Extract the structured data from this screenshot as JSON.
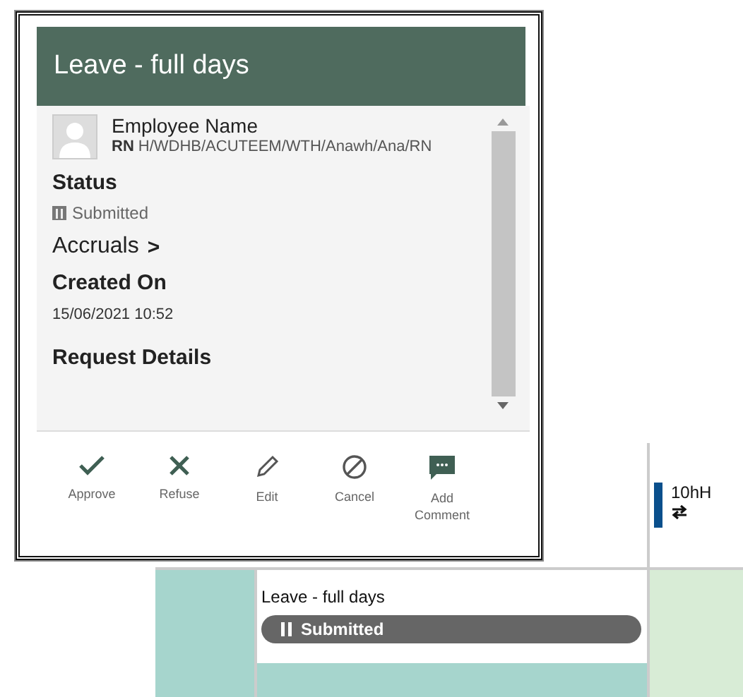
{
  "dialog": {
    "title": "Leave - full days",
    "employee": {
      "name": "Employee Name",
      "role": "RN",
      "path": "H/WDHB/ACUTEEM/WTH/Anawh/Ana/RN"
    },
    "sections": [
      {
        "kind": "status",
        "heading": "Status",
        "value": "Submitted"
      },
      {
        "kind": "link",
        "heading": "Accruals",
        "chevron": ">"
      },
      {
        "kind": "field",
        "heading": "Created On",
        "value": "15/06/2021 10:52"
      },
      {
        "kind": "heading",
        "heading": "Request Details"
      }
    ],
    "actions": [
      {
        "kind": "approve",
        "label": "Approve"
      },
      {
        "kind": "refuse",
        "label": "Refuse"
      },
      {
        "kind": "edit",
        "label": "Edit"
      },
      {
        "kind": "cancel",
        "label": "Cancel"
      },
      {
        "kind": "comment",
        "label": "Add Comment"
      }
    ]
  },
  "calendar": {
    "shift": {
      "label": "10hH"
    },
    "entry": {
      "title": "Leave - full days",
      "status": "Submitted"
    }
  }
}
